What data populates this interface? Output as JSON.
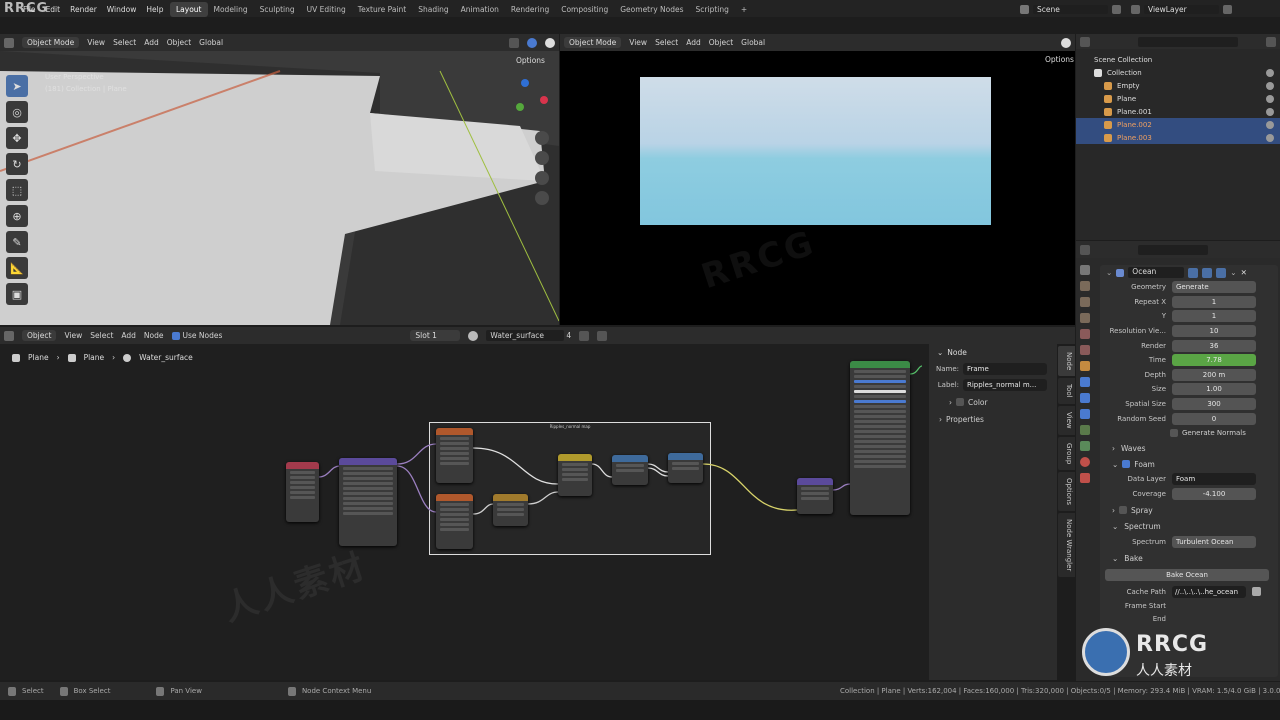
{
  "menubar": {
    "logo": "RRCG",
    "items": [
      "File",
      "Edit",
      "Render",
      "Window",
      "Help"
    ],
    "workspaces": [
      "Layout",
      "Modeling",
      "Sculpting",
      "UV Editing",
      "Texture Paint",
      "Shading",
      "Animation",
      "Rendering",
      "Compositing",
      "Geometry Nodes",
      "Scripting"
    ],
    "active_workspace": "Layout",
    "add_tab": "+",
    "scene": "Scene",
    "view_layer": "ViewLayer"
  },
  "viewport_left": {
    "mode": "Object Mode",
    "menu": [
      "View",
      "Select",
      "Add",
      "Object"
    ],
    "orientation": "Global",
    "options": "Options",
    "overlay_title": "User Perspective",
    "overlay_sub": "(181) Collection | Plane"
  },
  "viewport_right": {
    "mode": "Object Mode",
    "menu": [
      "View",
      "Select",
      "Add",
      "Object"
    ],
    "orientation": "Global",
    "options": "Options"
  },
  "outliner": {
    "title": "Scene Collection",
    "items": [
      {
        "name": "Collection",
        "indent": 1
      },
      {
        "name": "Empty",
        "indent": 2
      },
      {
        "name": "Plane",
        "indent": 2
      },
      {
        "name": "Plane.001",
        "indent": 2
      },
      {
        "name": "Plane.002",
        "indent": 2,
        "selected": true
      },
      {
        "name": "Plane.003",
        "indent": 2,
        "selected": true
      }
    ]
  },
  "node_editor": {
    "type": "Object",
    "menu": [
      "View",
      "Select",
      "Add",
      "Node"
    ],
    "use_nodes": "Use Nodes",
    "slot": "Slot 1",
    "material": "Water_surface",
    "users": "4",
    "breadcrumb": [
      "Plane",
      "Plane",
      "Water_surface"
    ],
    "frame_label": "Ripples_normal map",
    "sidebar": {
      "section": "Node",
      "name_label": "Name:",
      "name_value": "Frame",
      "label_label": "Label:",
      "label_value": "Ripples_normal m...",
      "color": "Color",
      "properties": "Properties"
    },
    "tabs": [
      "Node",
      "Tool",
      "View",
      "Group",
      "Options",
      "Node Wrangler"
    ]
  },
  "properties": {
    "modifier": "Ocean",
    "rows": [
      {
        "label": "Geometry",
        "value": "Generate"
      },
      {
        "label": "Repeat X",
        "value": "1"
      },
      {
        "label": "Y",
        "value": "1"
      },
      {
        "label": "Resolution Vie...",
        "value": "10"
      },
      {
        "label": "Render",
        "value": "36"
      },
      {
        "label": "Time",
        "value": "7.78"
      },
      {
        "label": "Depth",
        "value": "200 m"
      },
      {
        "label": "Size",
        "value": "1.00"
      },
      {
        "label": "Spatial Size",
        "value": "300"
      },
      {
        "label": "Random Seed",
        "value": "0"
      }
    ],
    "generate_normals": "Generate Normals",
    "waves": "Waves",
    "foam": "Foam",
    "data_layer_label": "Data Layer",
    "data_layer": "Foam",
    "coverage_label": "Coverage",
    "coverage": "-4.100",
    "spray": "Spray",
    "spectrum_section": "Spectrum",
    "spectrum_label": "Spectrum",
    "spectrum": "Turbulent Ocean",
    "bake": "Bake",
    "bake_button": "Bake Ocean",
    "cache_label": "Cache Path",
    "cache_path": "//..\\..\\..\\..he_ocean",
    "frame_start": "Frame Start",
    "frame_end": "End",
    "accent": "#5aa545"
  },
  "statusbar": {
    "select": "Select",
    "box_select": "Box Select",
    "pan_view": "Pan View",
    "context": "Node Context Menu",
    "stats": "Collection | Plane | Verts:162,004 | Faces:160,000 | Tris:320,000 | Objects:0/5 | Memory: 293.4 MiB | VRAM: 1.5/4.0 GiB | 3.0.0"
  },
  "watermark": "RRCG",
  "watermark_cn": "人人素材"
}
